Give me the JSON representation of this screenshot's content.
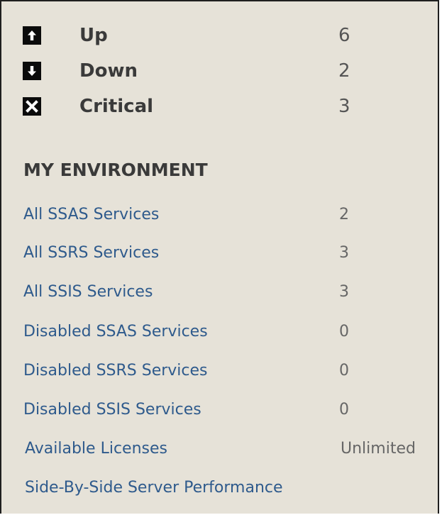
{
  "status": {
    "items": [
      {
        "label": "Up",
        "count": "6",
        "icon": "arrow-up-icon"
      },
      {
        "label": "Down",
        "count": "2",
        "icon": "arrow-down-icon"
      },
      {
        "label": "Critical",
        "count": "3",
        "icon": "close-icon"
      }
    ]
  },
  "environment": {
    "heading": "MY ENVIRONMENT",
    "items": [
      {
        "label": "All SSAS Services",
        "value": "2"
      },
      {
        "label": "All SSRS Services",
        "value": "3"
      },
      {
        "label": "All SSIS Services",
        "value": "3"
      },
      {
        "label": "Disabled SSAS Services",
        "value": "0"
      },
      {
        "label": "Disabled SSRS Services",
        "value": "0"
      },
      {
        "label": "Disabled SSIS Services",
        "value": "0"
      },
      {
        "label": "Available Licenses",
        "value": "Unlimited"
      },
      {
        "label": "Side-By-Side Server Performance",
        "value": ""
      }
    ]
  },
  "colors": {
    "background": "#e6e2d8",
    "link": "#2e5a8c",
    "icon": "#0b0b0b"
  }
}
